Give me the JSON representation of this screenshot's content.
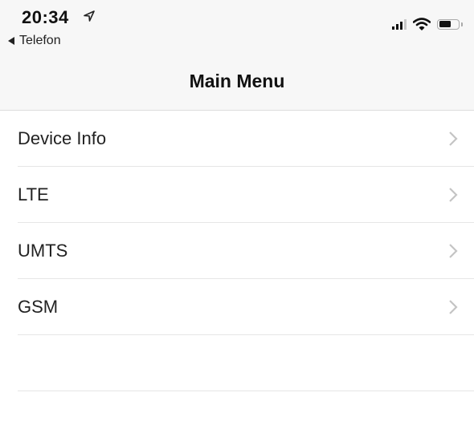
{
  "status_bar": {
    "time": "20:34",
    "back_app": "Telefon",
    "icons": [
      "location-arrow-icon",
      "cellular-signal-icon",
      "wifi-icon",
      "battery-icon"
    ],
    "signal_bars_active": 3,
    "signal_bars_total": 4,
    "battery_level": 0.65
  },
  "nav": {
    "title": "Main Menu"
  },
  "menu": {
    "items": [
      {
        "label": "Device Info",
        "icon": "chevron-right-icon"
      },
      {
        "label": "LTE",
        "icon": "chevron-right-icon"
      },
      {
        "label": "UMTS",
        "icon": "chevron-right-icon"
      },
      {
        "label": "GSM",
        "icon": "chevron-right-icon"
      }
    ]
  }
}
